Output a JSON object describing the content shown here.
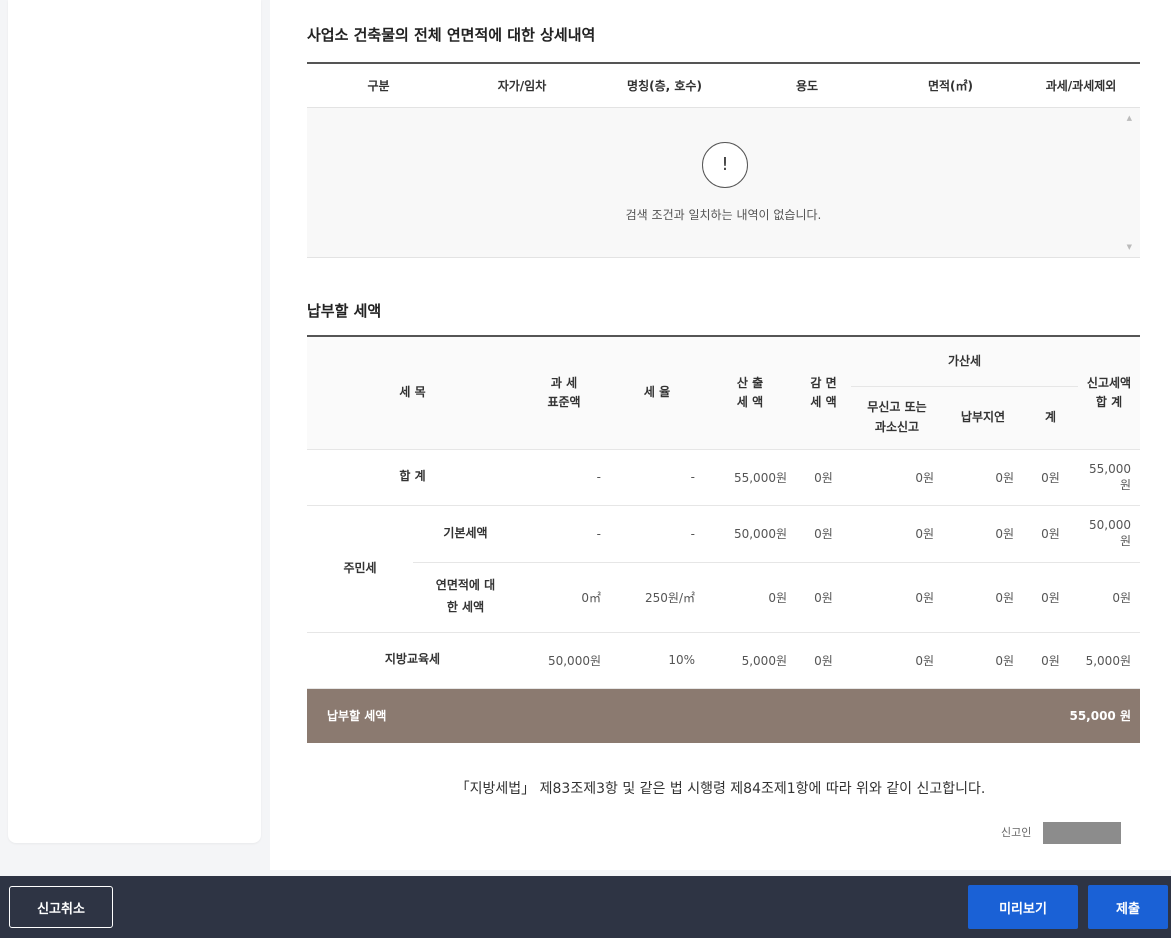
{
  "building_section": {
    "title": "사업소 건축물의 전체 연면적에 대한 상세내역",
    "columns": [
      "구분",
      "자가/임차",
      "명칭(층, 호수)",
      "용도",
      "면적(㎡)",
      "과세/과세제외"
    ],
    "empty_message": "검색 조건과 일치하는 내역이 없습니다.",
    "empty_icon": "exclamation-circle-icon",
    "empty_icon_glyph": "!"
  },
  "tax_section": {
    "title": "납부할 세액",
    "headers": {
      "item": "세 목",
      "base": "과 세\n표준액",
      "rate": "세 율",
      "calc": "산 출\n세 액",
      "reduce": "감 면\n세 액",
      "penalty": "가산세",
      "penalty_unreported": "무신고 또는\n과소신고",
      "penalty_late": "납부지연",
      "penalty_sum": "계",
      "total": "신고세액\n합 계"
    },
    "rows": {
      "sum": {
        "label": "합 계",
        "base": "-",
        "rate": "-",
        "calc": "55,000원",
        "reduce": "0원",
        "unreported": "0원",
        "late": "0원",
        "psum": "0원",
        "total": "55,000원"
      },
      "resident_group": "주민세",
      "basic": {
        "label": "기본세액",
        "base": "-",
        "rate": "-",
        "calc": "50,000원",
        "reduce": "0원",
        "unreported": "0원",
        "late": "0원",
        "psum": "0원",
        "total": "50,000원"
      },
      "area": {
        "label": "연면적에 대\n한 세액",
        "base": "0㎡",
        "rate": "250원/㎡",
        "calc": "0원",
        "reduce": "0원",
        "unreported": "0원",
        "late": "0원",
        "psum": "0원",
        "total": "0원"
      },
      "edu": {
        "label": "지방교육세",
        "base": "50,000원",
        "rate": "10%",
        "calc": "5,000원",
        "reduce": "0원",
        "unreported": "0원",
        "late": "0원",
        "psum": "0원",
        "total": "5,000원"
      }
    },
    "payable": {
      "label": "납부할 세액",
      "amount": "55,000 원"
    }
  },
  "declaration": "「지방세법」 제83조제3항 및 같은 법 시행령 제84조제1항에 따라 위와 같이 신고합니다.",
  "reporter_label": "신고인",
  "footer": {
    "cancel": "신고취소",
    "preview": "미리보기",
    "submit": "제출"
  }
}
